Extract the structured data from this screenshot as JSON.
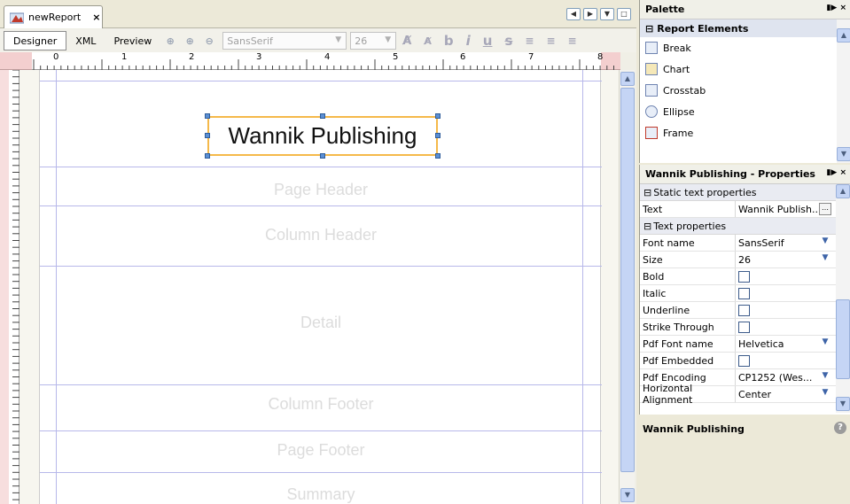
{
  "tab": {
    "title": "newReport",
    "close": "×"
  },
  "toolbar": {
    "modes": [
      "Designer",
      "XML",
      "Preview"
    ],
    "font_value": "SansSerif",
    "size_value": "26",
    "format_glyphs": [
      "b",
      "i",
      "u",
      "s"
    ]
  },
  "ruler": {
    "labels": [
      "0",
      "1",
      "2",
      "3",
      "4",
      "5",
      "6",
      "7",
      "8"
    ]
  },
  "canvas": {
    "static_text": "Wannik Publishing",
    "bands": [
      "Page Header",
      "Column Header",
      "Detail",
      "Column Footer",
      "Page Footer",
      "Summary"
    ]
  },
  "palette": {
    "title": "Palette",
    "category": "Report Elements",
    "items": [
      "Break",
      "Chart",
      "Crosstab",
      "Ellipse",
      "Frame"
    ]
  },
  "properties": {
    "title": "Wannik Publishing - Properties",
    "static_category": "Static text properties",
    "text_label": "Text",
    "text_value": "Wannik Publish...",
    "text_category": "Text properties",
    "font_name_label": "Font name",
    "font_name_value": "SansSerif",
    "size_label": "Size",
    "size_value": "26",
    "bold_label": "Bold",
    "italic_label": "Italic",
    "underline_label": "Underline",
    "strike_label": "Strike Through",
    "pdf_font_label": "Pdf Font name",
    "pdf_font_value": "Helvetica",
    "pdf_embedded_label": "Pdf Embedded",
    "pdf_encoding_label": "Pdf Encoding",
    "pdf_encoding_value": "CP1252 (Wes...",
    "halign_label": "Horizontal Alignment",
    "halign_value": "Center"
  },
  "help": {
    "title": "Wannik Publishing",
    "icon": "?"
  }
}
